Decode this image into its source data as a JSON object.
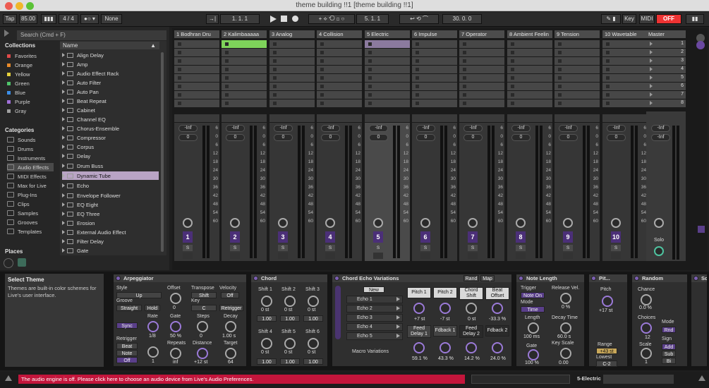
{
  "window": {
    "title": "theme building !!1  [theme building !!1]"
  },
  "control": {
    "tap": "Tap",
    "tempo": "85.00",
    "time_sig": "4 / 4",
    "quant": "None",
    "pos": "1.   1.   1",
    "loop_start": "5.   1.   1",
    "loop_len": "30.   0.   0",
    "key": "Key",
    "midi": "MIDI",
    "off": "OFF"
  },
  "browser": {
    "search_placeholder": "Search (Cmd + F)",
    "collections_title": "Collections",
    "collections": [
      {
        "label": "Favorites",
        "color": "#e04a4a"
      },
      {
        "label": "Orange",
        "color": "#e88a2a"
      },
      {
        "label": "Yellow",
        "color": "#e6d13c"
      },
      {
        "label": "Green",
        "color": "#4fc36a"
      },
      {
        "label": "Blue",
        "color": "#3c8ee8"
      },
      {
        "label": "Purple",
        "color": "#a070d8"
      },
      {
        "label": "Gray",
        "color": "#a0a0a0"
      }
    ],
    "categories_title": "Categories",
    "categories": [
      "Sounds",
      "Drums",
      "Instruments",
      "Audio Effects",
      "MIDI Effects",
      "Max for Live",
      "Plug-Ins",
      "Clips",
      "Samples",
      "Grooves",
      "Templates"
    ],
    "places_title": "Places",
    "list_header": "Name",
    "items": [
      "Align Delay",
      "Amp",
      "Audio Effect Rack",
      "Auto Filter",
      "Auto Pan",
      "Beat Repeat",
      "Cabinet",
      "Channel EQ",
      "Chorus-Ensemble",
      "Compressor",
      "Corpus",
      "Delay",
      "Drum Buss",
      "Dynamic Tube",
      "Echo",
      "Envelope Follower",
      "EQ Eight",
      "EQ Three",
      "Erosion",
      "External Audio Effect",
      "Filter Delay",
      "Gate"
    ],
    "selected_item": "Dynamic Tube"
  },
  "tracks": [
    {
      "name": "1 Bodhran Dru",
      "num": "1"
    },
    {
      "name": "2 Kalimbaaaaa",
      "num": "2"
    },
    {
      "name": "3 Analog",
      "num": "3"
    },
    {
      "name": "4 Collision",
      "num": "4"
    },
    {
      "name": "5 Electric",
      "num": "5"
    },
    {
      "name": "6 Impulse",
      "num": "6"
    },
    {
      "name": "7 Operator",
      "num": "7"
    },
    {
      "name": "8 Ambient Feelin",
      "num": "8"
    },
    {
      "name": "9 Tension",
      "num": "9"
    },
    {
      "name": "10 Wavetable",
      "num": "10"
    }
  ],
  "master": {
    "name": "Master",
    "scenes": [
      "1",
      "2",
      "3",
      "4",
      "5",
      "6",
      "7",
      "8"
    ],
    "solo": "Solo"
  },
  "mixer": {
    "vol": "-Inf",
    "pan": "0",
    "s": "S",
    "scale": [
      "6",
      "0",
      "6",
      "12",
      "18",
      "24",
      "30",
      "36",
      "42",
      "48",
      "54",
      "60"
    ]
  },
  "info": {
    "title": "Select Theme",
    "body": "Themes are built-in color schemes for Live's user interface."
  },
  "devices": {
    "arp": {
      "title": "Arpeggiator",
      "style_l": "Style",
      "style": "Up",
      "offset_l": "Offset",
      "offset": "0",
      "transpose_l": "Transpose",
      "transpose": "Shift",
      "velocity_l": "Velocity",
      "velocity": "Off",
      "groove_l": "Groove",
      "groove": "Straight",
      "hold": "Hold",
      "key_l": "Key",
      "key": "C",
      "retrigger_btn": "Retrigger",
      "sync": "Sync",
      "rate_l": "Rate",
      "rate": "1/8",
      "gate_l": "Gate",
      "gate": "50 %",
      "steps_l": "Steps",
      "steps": "0",
      "decay_l": "Decay",
      "decay": "1.00 s",
      "retrigger_l": "Retrigger",
      "beat": "Beat",
      "note": "Note",
      "off": "Off",
      "knob1": "1",
      "repeats_l": "Repeats",
      "repeats": "inf",
      "distance_l": "Distance",
      "distance": "+12 st",
      "target_l": "Target",
      "target": "64"
    },
    "chord": {
      "title": "Chord",
      "s1": "Shift 1",
      "s2": "Shift 2",
      "s3": "Shift 3",
      "s4": "Shift 4",
      "s5": "Shift 5",
      "s6": "Shift 6",
      "st": "0 st",
      "v": "1.00"
    },
    "echo": {
      "title": "Chord Echo Variations",
      "rand": "Rand",
      "map": "Map",
      "new": "New",
      "echoes": [
        "Echo 1",
        "Echo 2",
        "Echo 3",
        "Echo 4",
        "Echo 5"
      ],
      "macro": "Macro Variations",
      "p1": "Pitch 1",
      "p2": "Pitch 2",
      "cs": "Chord Shift",
      "bo": "Beat Offset",
      "v1": "+7 st",
      "v2": "-7 st",
      "v3": "0 st",
      "v4": "-33.3 %",
      "fd1": "Feed Delay 1",
      "fb1": "Fdback 1",
      "fd2": "Feed Delay 2",
      "fb2": "Fdback 2",
      "v5": "59.1 %",
      "v6": "43.3 %",
      "v7": "14.2 %",
      "v8": "24.0 %"
    },
    "nl": {
      "title": "Note Length",
      "trigger_l": "Trigger",
      "trigger": "Note On",
      "release_l": "Release Vel.",
      "release": "0 %",
      "mode_l": "Mode",
      "mode": "Time",
      "length_l": "Length",
      "length": "100 ms",
      "decay_l": "Decay Time",
      "decay": "60.0 s",
      "gate_l": "Gate",
      "gate": "100 %",
      "keyscale_l": "Key Scale",
      "keyscale": "0.00"
    },
    "pitch": {
      "title": "Pit...",
      "pitch_l": "Pitch",
      "pitch": "+17 st",
      "range_l": "Range",
      "range": "+43 st",
      "lowest_l": "Lowest",
      "lowest": "C-2"
    },
    "random": {
      "title": "Random",
      "chance_l": "Chance",
      "chance": "0.0 %",
      "choices_l": "Choices",
      "choices": "12",
      "mode_l": "Mode",
      "mode": "Rnd",
      "scale_l": "Scale",
      "scale": "1",
      "sign_l": "Sign",
      "add": "Add",
      "sub": "Sub",
      "bi": "Bi"
    },
    "scale": {
      "title": "Scal"
    }
  },
  "status": {
    "message": "The audio engine is off. Please click here to choose an audio device from Live's Audio Preferences.",
    "track": "5-Electric"
  }
}
